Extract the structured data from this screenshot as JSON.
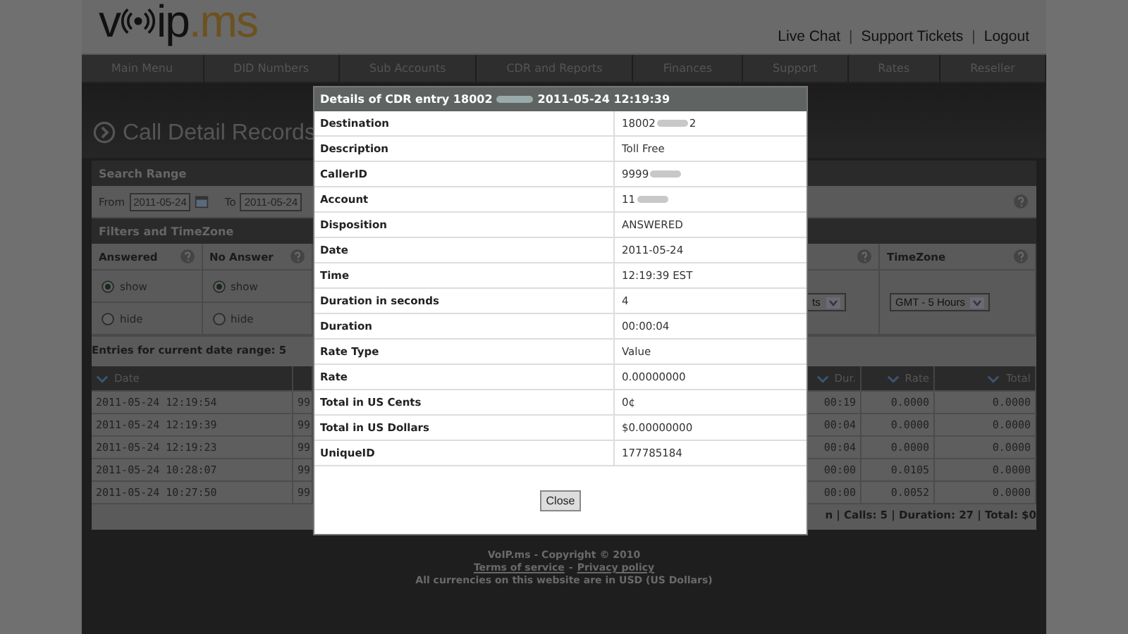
{
  "logo": {
    "text_before": "v",
    "text_after": "ip",
    "suffix": ".ms"
  },
  "header_links": [
    "Live Chat",
    "Support Tickets",
    "Logout"
  ],
  "header_link_separator": "|",
  "nav": [
    "Main Menu",
    "DID Numbers",
    "Sub Accounts",
    "CDR and Reports",
    "Finances",
    "Support",
    "Rates",
    "Reseller"
  ],
  "page_title": "Call Detail Records",
  "search_range": {
    "title": "Search Range",
    "from_label": "From",
    "from_value": "2011-05-24",
    "to_label": "To",
    "to_value": "2011-05-24"
  },
  "filters": {
    "title": "Filters and TimeZone",
    "columns": [
      {
        "title": "Answered",
        "options": [
          {
            "label": "show",
            "selected": true
          },
          {
            "label": "hide",
            "selected": false
          }
        ]
      },
      {
        "title": "No Answer",
        "options": [
          {
            "label": "show",
            "selected": true
          },
          {
            "label": "hide",
            "selected": false
          }
        ]
      }
    ],
    "partial_select": "ts",
    "timezone": {
      "title": "TimeZone",
      "value": "GMT - 5 Hours"
    }
  },
  "entries_label": "Entries for current date range: 5",
  "table": {
    "left_columns": [
      "Date"
    ],
    "right_columns": [
      "Dur.",
      "Rate",
      "Total"
    ],
    "rows": [
      {
        "date": "2011-05-24 12:19:54",
        "column_2": "99",
        "dur": "00:19",
        "rate": "0.0000",
        "total": "0.0000"
      },
      {
        "date": "2011-05-24 12:19:39",
        "column_2": "99",
        "dur": "00:04",
        "rate": "0.0000",
        "total": "0.0000"
      },
      {
        "date": "2011-05-24 12:19:23",
        "column_2": "99",
        "dur": "00:04",
        "rate": "0.0000",
        "total": "0.0000"
      },
      {
        "date": "2011-05-24 10:28:07",
        "column_2": "99",
        "dur": "00:00",
        "rate": "0.0105",
        "total": "0.0000"
      },
      {
        "date": "2011-05-24 10:27:50",
        "column_2": "99",
        "dur": "00:00",
        "rate": "0.0052",
        "total": "0.0000"
      }
    ],
    "summary": "n | Calls: 5 | Duration: 27 | Total: $0"
  },
  "footer": {
    "copyright": "VoIP.ms - Copyright © 2010",
    "links": [
      "Terms of service",
      "Privacy policy"
    ],
    "separator": "-",
    "note": "All currencies on this website are in USD (US Dollars)"
  },
  "modal": {
    "title_before": "Details of CDR entry 18002",
    "title_redacted": true,
    "title_after": "2011-05-24 12:19:39",
    "rows": [
      {
        "label": "Destination",
        "value": "18002",
        "redacted": true,
        "value_after": "2"
      },
      {
        "label": "Description",
        "value": "Toll Free",
        "redacted": false
      },
      {
        "label": "CallerID",
        "value": "9999",
        "redacted": true
      },
      {
        "label": "Account",
        "value": "11",
        "redacted": true
      },
      {
        "label": "Disposition",
        "value": "ANSWERED",
        "redacted": false
      },
      {
        "label": "Date",
        "value": "2011-05-24",
        "redacted": false
      },
      {
        "label": "Time",
        "value": "12:19:39 EST",
        "redacted": false
      },
      {
        "label": "Duration in seconds",
        "value": "4",
        "redacted": false
      },
      {
        "label": "Duration",
        "value": "00:00:04",
        "redacted": false
      },
      {
        "label": "Rate Type",
        "value": "Value",
        "redacted": false
      },
      {
        "label": "Rate",
        "value": "0.00000000",
        "redacted": false
      },
      {
        "label": "Total in US Cents",
        "value": "0¢",
        "redacted": false
      },
      {
        "label": "Total in US Dollars",
        "value": "$0.00000000",
        "redacted": false
      },
      {
        "label": "UniqueID",
        "value": "177785184",
        "redacted": false
      }
    ],
    "close": "Close"
  }
}
